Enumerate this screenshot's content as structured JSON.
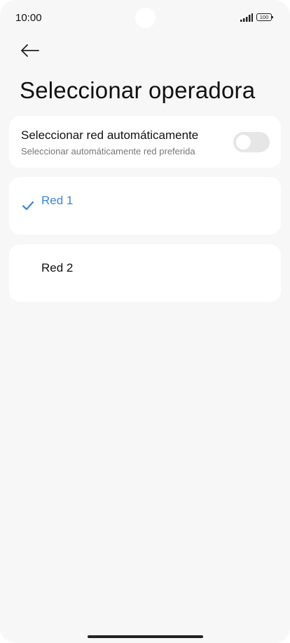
{
  "status_bar": {
    "time": "10:00",
    "battery_level": "100",
    "signal_icon": "signal-bars-icon"
  },
  "header": {
    "back_icon": "arrow-left-icon",
    "title": "Seleccionar operadora"
  },
  "auto_select": {
    "title": "Seleccionar red automáticamente",
    "subtitle": "Seleccionar automáticamente red preferida",
    "toggle_on": false
  },
  "networks": [
    {
      "label": "Red 1",
      "selected": true,
      "icon": "checkmark-icon"
    },
    {
      "label": "Red 2",
      "selected": false
    }
  ],
  "colors": {
    "accent": "#3a86d6",
    "background": "#f7f7f7",
    "card": "#ffffff",
    "toggle_off": "#e6e6e6"
  }
}
